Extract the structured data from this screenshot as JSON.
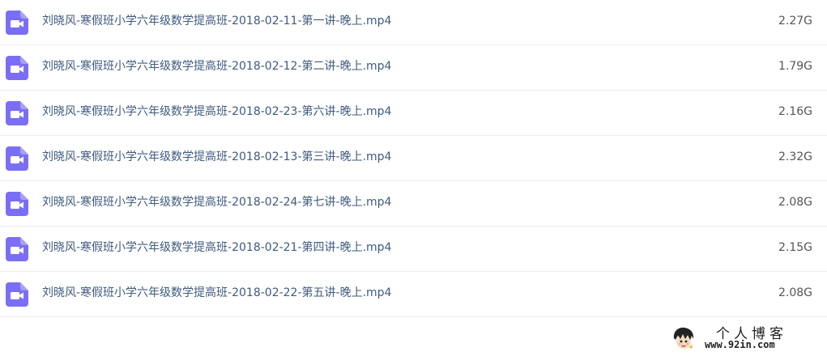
{
  "files": [
    {
      "name": "刘晓风-寒假班小学六年级数学提高班-2018-02-11-第一讲-晚上.mp4",
      "size": "2.27G",
      "icon": "video-file-icon"
    },
    {
      "name": "刘晓风-寒假班小学六年级数学提高班-2018-02-12-第二讲-晚上.mp4",
      "size": "1.79G",
      "icon": "video-file-icon"
    },
    {
      "name": "刘晓风-寒假班小学六年级数学提高班-2018-02-23-第六讲-晚上.mp4",
      "size": "2.16G",
      "icon": "video-file-icon"
    },
    {
      "name": "刘晓风-寒假班小学六年级数学提高班-2018-02-13-第三讲-晚上.mp4",
      "size": "2.32G",
      "icon": "video-file-icon"
    },
    {
      "name": "刘晓风-寒假班小学六年级数学提高班-2018-02-24-第七讲-晚上.mp4",
      "size": "2.08G",
      "icon": "video-file-icon"
    },
    {
      "name": "刘晓风-寒假班小学六年级数学提高班-2018-02-21-第四讲-晚上.mp4",
      "size": "2.15G",
      "icon": "video-file-icon"
    },
    {
      "name": "刘晓风-寒假班小学六年级数学提高班-2018-02-22-第五讲-晚上.mp4",
      "size": "2.08G",
      "icon": "video-file-icon"
    }
  ],
  "watermark": {
    "title": "个人博客",
    "url": "www.92in.com"
  },
  "colors": {
    "icon": "#7b6ef6",
    "filename": "#3e5a80",
    "size": "#555555",
    "divider": "#eeeeee"
  }
}
